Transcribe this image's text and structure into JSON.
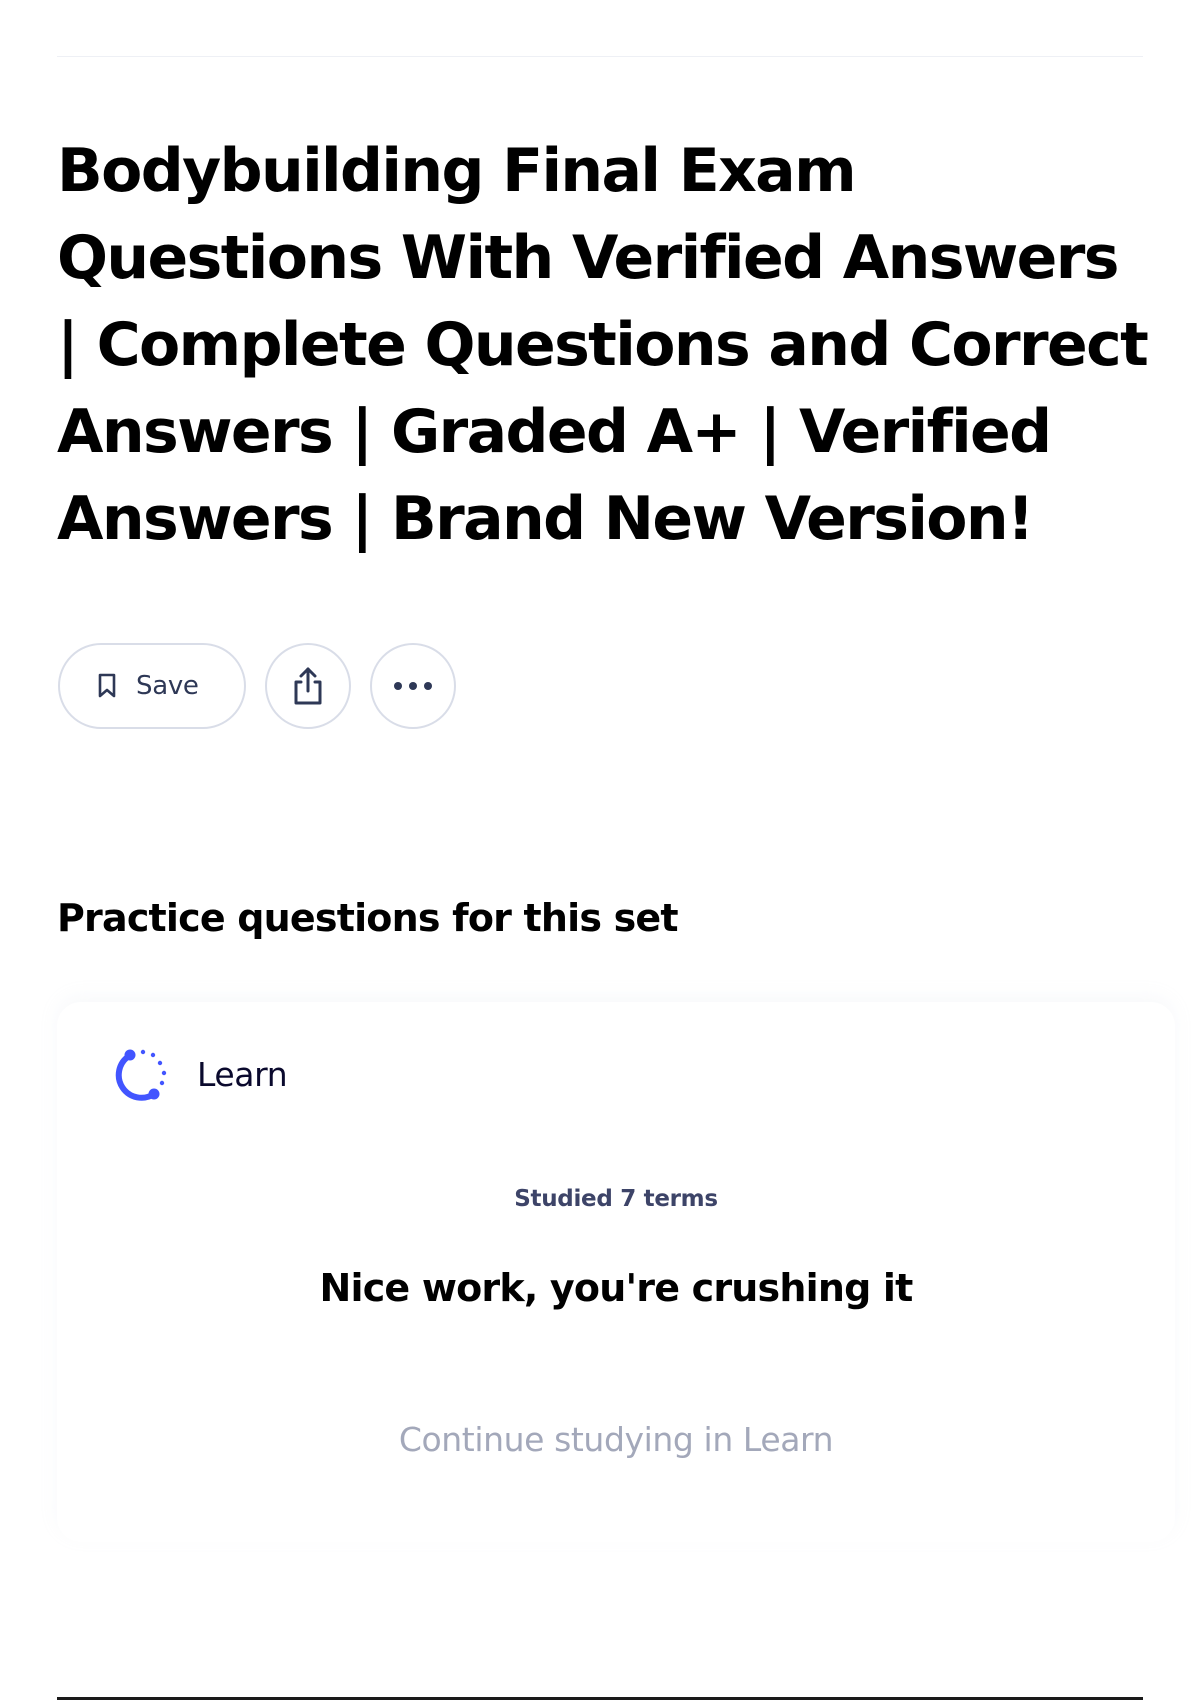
{
  "set": {
    "title": "Bodybuilding Final Exam Questions With Verified Answers | Complete Questions and Correct Answers | Graded A+ | Verified Answers | Brand New Version!"
  },
  "actions": {
    "save_label": "Save",
    "save_icon": "bookmark-icon",
    "share_icon": "share-icon",
    "more_icon": "more-horizontal-icon"
  },
  "practice": {
    "heading": "Practice questions for this set",
    "card": {
      "title": "Learn",
      "icon": "learn-progress-icon",
      "studied_text": "Studied 7 terms",
      "message": "Nice work, you're crushing it",
      "continue_label": "Continue studying in Learn"
    }
  },
  "colors": {
    "accent": "#4255ff",
    "text": "#000000",
    "muted_link": "#a3a8ba",
    "border": "#d9dde8"
  }
}
